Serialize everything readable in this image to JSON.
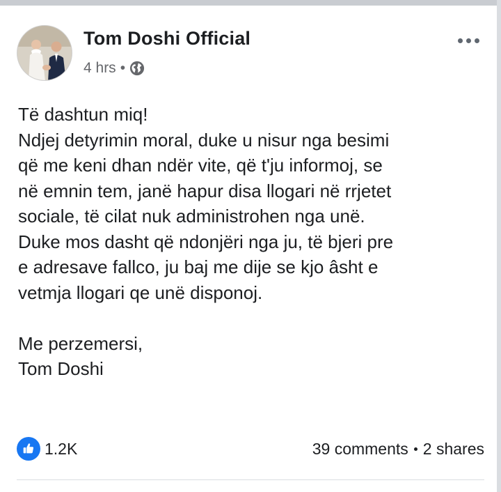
{
  "post": {
    "author": "Tom Doshi Official",
    "time": "4 hrs",
    "separator": "•",
    "privacy_icon": "globe-icon",
    "more_icon": "more-horizontal-icon",
    "body_lines": [
      "Të dashtun miq!",
      "Ndjej detyrimin moral, duke u nisur nga besimi",
      "që me keni dhan ndër vite, që t'ju informoj, se",
      "në emnin tem, janë hapur disa llogari në rrjetet",
      "sociale, të cilat nuk administrohen nga unë.",
      "Duke mos dasht që ndonjëri nga ju, të bjeri pre",
      "e adresave fallco, ju baj me dije se kjo âsht e",
      "vetmja llogari qe unë disponoj."
    ],
    "closing_lines": [
      "Me perzemersi,",
      "Tom Doshi"
    ]
  },
  "reactions": {
    "icon": "like-icon",
    "count": "1.2K",
    "comments": "39 comments",
    "shares": "2 shares"
  },
  "colors": {
    "accent": "#1877f2",
    "text": "#1c1e21",
    "secondary": "#65676b"
  }
}
